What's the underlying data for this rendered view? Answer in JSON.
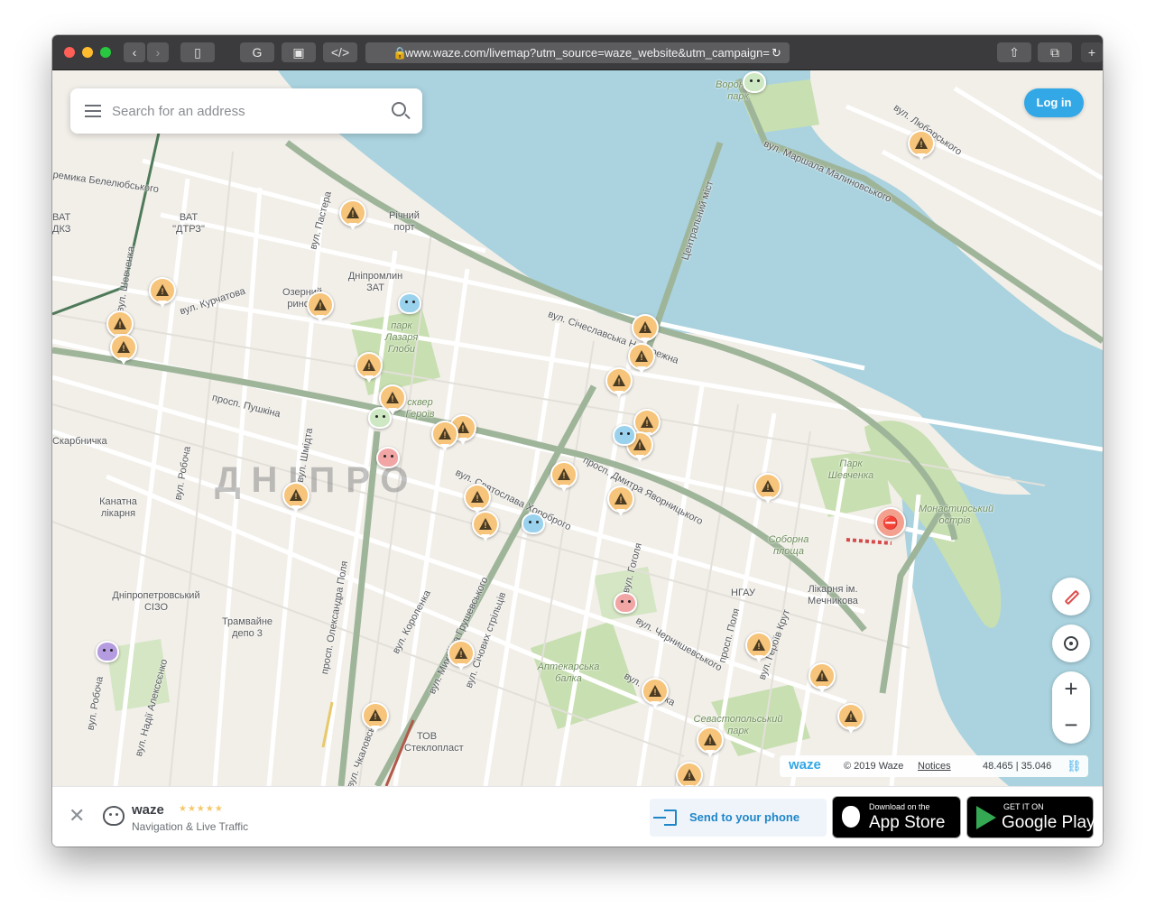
{
  "browser": {
    "url": "www.waze.com/livemap?utm_source=waze_website&utm_campaign="
  },
  "search": {
    "placeholder": "Search for an address"
  },
  "login_label": "Log in",
  "map": {
    "city_label": "ДНІПРО",
    "labels": [
      "вул. Любарського",
      "вул. Маршала Малиновського",
      "Центральний міст",
      "вул. Січеславська Набережна",
      "Річний порт",
      "ВАТ \"ДТРЗ\"",
      "ВАТ ДКЗ",
      "ремика Белелюбського",
      "Дніпромлин ЗАТ",
      "вул. Курчатова",
      "вул. Шевченка",
      "вул. Пастера",
      "просп. Пушкіна",
      "вул. Шмідта",
      "вул. Робоча",
      "Канатна лікарня",
      "Дніпропетровський СІЗО",
      "Трамвайне депо 3",
      "просп. Олександра Поля",
      "вул. Короленка",
      "вул. Михайла Грушевського",
      "вул. Січових стрільців",
      "вул. Святослава Хороброго",
      "просп. Дмитра Яворницького",
      "вул. Гоголя",
      "вул. Чернишевського",
      "вул. Гусенка",
      "НГАУ",
      "Лікарня ім. Мечникова",
      "вул. Надії Алексєєнко",
      "вул. Робоча",
      "ТОВ Стеклопласт",
      "вул. Героїв Крут",
      "просп. Поля",
      "вул. Чкаловського",
      "Скарбничка"
    ],
    "park_labels": [
      "Воронцов парк",
      "парк Лазаря Глоби",
      "сквер Героїв",
      "Парк Шевченка",
      "Монастирський острів",
      "Соборна площа",
      "Аптекарська балка",
      "Севастопольський парк",
      "Озерний ринок"
    ]
  },
  "attribution": {
    "logo": "waze",
    "copyright": "© 2019 Waze",
    "notices": "Notices",
    "coords": "48.465 | 35.046"
  },
  "banner": {
    "app_name": "waze",
    "tagline": "Navigation & Live Traffic",
    "stars": "★★★★★",
    "send_label": "Send to your phone",
    "appstore_small": "Download on the",
    "appstore_big": "App Store",
    "gplay_small": "GET IT ON",
    "gplay_big": "Google Play"
  },
  "colors": {
    "water": "#aad3df",
    "land": "#f2efe9",
    "park": "#c8dfb1",
    "road": "#ffffff",
    "major_road": "#9fb59a",
    "alert_pin": "#f6c47a",
    "login_blue": "#33a8e6",
    "send_blue": "#1f86c9"
  },
  "icons": [
    "search-icon",
    "menu-icon",
    "alert-icon",
    "wazer-icon",
    "pencil-icon",
    "locate-icon",
    "zoom-in-icon",
    "zoom-out-icon",
    "close-icon",
    "link-icon",
    "apple-icon",
    "google-play-icon",
    "send-to-phone-icon"
  ]
}
